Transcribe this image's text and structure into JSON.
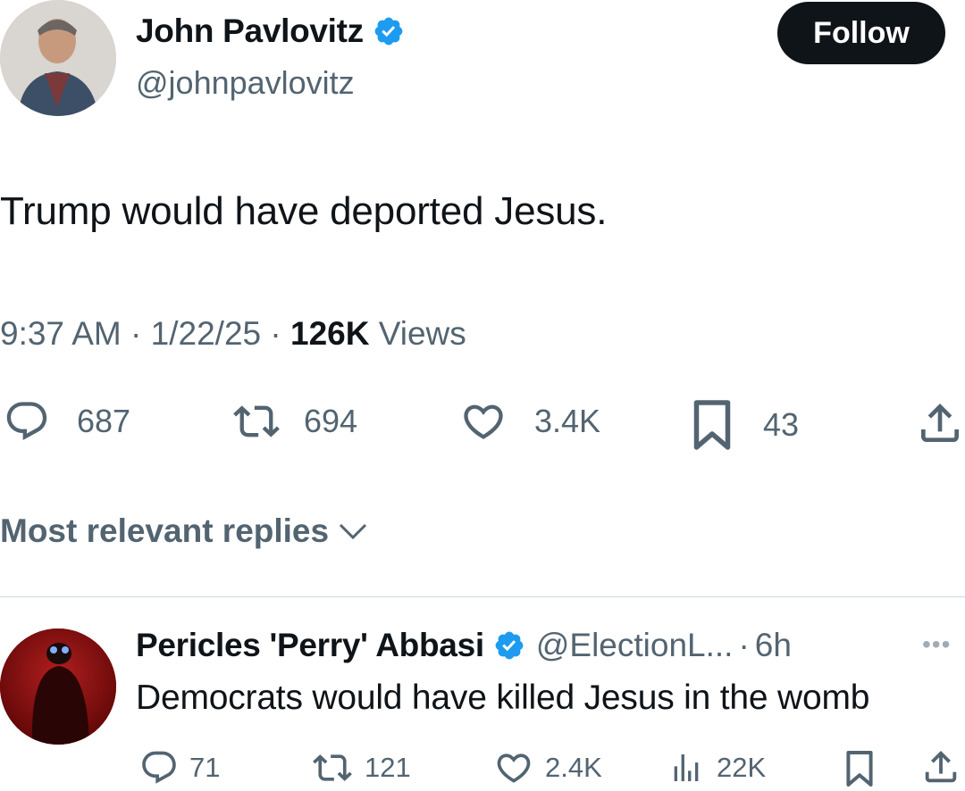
{
  "tweet": {
    "author_name": "John Pavlovitz",
    "author_handle": "@johnpavlovitz",
    "follow_label": "Follow",
    "text": "Trump would have deported Jesus.",
    "time": "9:37 AM",
    "date": "1/22/25",
    "views_count": "126K",
    "views_label": "Views",
    "stats": {
      "replies": "687",
      "reposts": "694",
      "likes": "3.4K",
      "bookmarks": "43"
    }
  },
  "replies_sort_label": "Most relevant replies",
  "reply": {
    "author_name": "Pericles 'Perry' Abbasi",
    "author_handle": "@ElectionL...",
    "separator": "·",
    "age": "6h",
    "more_label": "•••",
    "text": "Democrats would have killed Jesus in the womb",
    "stats": {
      "replies": "71",
      "reposts": "121",
      "likes": "2.4K",
      "views": "22K"
    }
  },
  "colors": {
    "text": "#0f1419",
    "secondary": "#536471",
    "verified": "#1d9bf0",
    "button": "#0f1419",
    "divider": "#cfd9de"
  },
  "icons": [
    "reply-icon",
    "repost-icon",
    "like-icon",
    "bookmark-icon",
    "share-icon",
    "views-icon",
    "verified-badge-icon",
    "chevron-down-icon",
    "more-icon"
  ]
}
